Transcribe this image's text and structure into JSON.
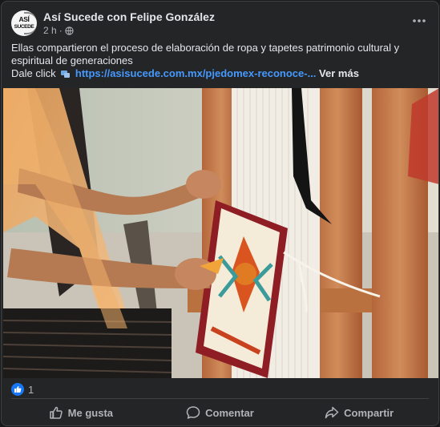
{
  "post": {
    "author": "Así Sucede con Felipe González",
    "time": "2 h",
    "separator": "·",
    "avatar_line1": "ASÍ",
    "avatar_line2": "SUCEDE",
    "text": "Ellas compartieron el proceso de elaboración de ropa y tapetes patrimonio cultural y espiritual de generaciones",
    "link_prefix": "Dale click",
    "link_text": "https://asisucede.com.mx/pjedomex-reconoce-",
    "link_ellipsis": "...",
    "see_more": "Ver más",
    "reaction_count": "1"
  },
  "actions": {
    "like": "Me gusta",
    "comment": "Comentar",
    "share": "Compartir"
  },
  "icons": {
    "more": "more-options-icon",
    "globe": "globe-icon",
    "link": "link-emoji-icon",
    "like": "thumbs-up-icon",
    "comment": "comment-bubble-icon",
    "share": "share-arrow-icon"
  },
  "colors": {
    "background": "#242526",
    "link": "#4599ff",
    "like_badge": "#1877f2"
  }
}
